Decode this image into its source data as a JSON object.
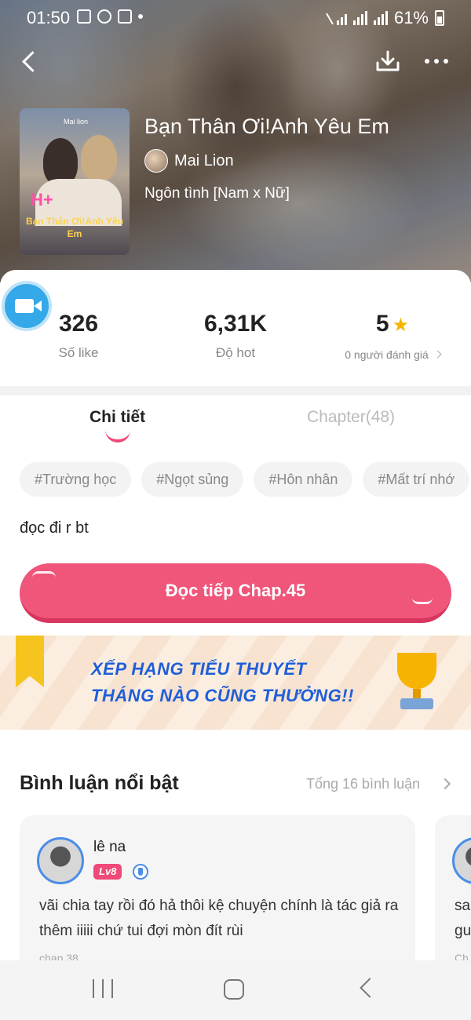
{
  "status_bar": {
    "time": "01:50",
    "battery": "61%"
  },
  "book": {
    "title": "Bạn Thân Ơi!Anh Yêu Em",
    "author": "Mai Lion",
    "genre": "Ngôn tình [Nam x Nữ]",
    "cover": {
      "small_text": "Mai lion",
      "badge": "H+",
      "title": "Bạn Thân Ơi!Anh Yêu Em"
    }
  },
  "stats": {
    "likes": {
      "value": "326",
      "label": "Số like"
    },
    "hot": {
      "value": "6,31K",
      "label": "Độ hot"
    },
    "rating": {
      "value": "5",
      "label": "0 người đánh giá"
    }
  },
  "tabs": [
    {
      "label": "Chi tiết",
      "active": true
    },
    {
      "label": "Chapter(48)",
      "active": false
    }
  ],
  "tags": [
    "#Trường học",
    "#Ngọt sủng",
    "#Hôn nhân",
    "#Mất trí nhớ"
  ],
  "description": "đọc đi r bt",
  "read_button": "Đọc tiếp Chap.45",
  "banner": {
    "line1": "XẾP HẠNG TIỂU THUYẾT",
    "line2": "THÁNG NÀO CŨNG THƯỞNG!!"
  },
  "comments_section": {
    "title": "Bình luận nổi bật",
    "total": "Tổng 16 bình luận",
    "comments": [
      {
        "user": "lê na",
        "level": "Lv8",
        "text": "vãi chia tay rồi đó hả thôi kệ chuyện chính là tác giả ra thêm iiiii chứ tui đợi mòn đít rùi",
        "chapter": "chap 38"
      },
      {
        "text": "sa\ngu",
        "chapter": "Ch"
      }
    ]
  },
  "colors": {
    "accent": "#f04878",
    "button": "#f0557a",
    "link_blue": "#1f5ed8",
    "star": "#f6b400"
  }
}
